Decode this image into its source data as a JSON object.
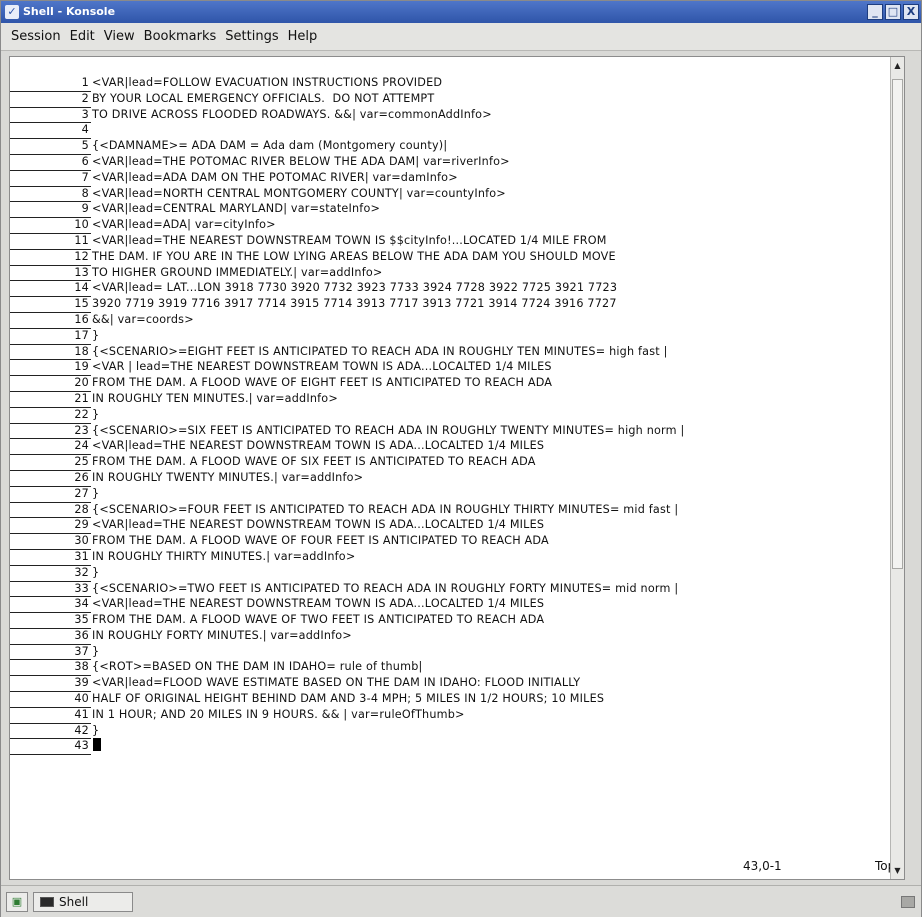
{
  "window": {
    "title": "Shell - Konsole",
    "buttons": [
      "_",
      "□",
      "X"
    ]
  },
  "menubar": {
    "items": [
      "Session",
      "Edit",
      "View",
      "Bookmarks",
      "Settings",
      "Help"
    ]
  },
  "terminal": {
    "lines": [
      {
        "n": "1",
        "text": "<VAR|lead=FOLLOW EVACUATION INSTRUCTIONS PROVIDED"
      },
      {
        "n": "2",
        "text": "BY YOUR LOCAL EMERGENCY OFFICIALS.  DO NOT ATTEMPT"
      },
      {
        "n": "3",
        "text": "TO DRIVE ACROSS FLOODED ROADWAYS. &&| var=commonAddInfo>"
      },
      {
        "n": "4",
        "text": ""
      },
      {
        "n": "5",
        "text": "{<DAMNAME>= ADA DAM = Ada dam (Montgomery county)|"
      },
      {
        "n": "6",
        "text": "<VAR|lead=THE POTOMAC RIVER BELOW THE ADA DAM| var=riverInfo>"
      },
      {
        "n": "7",
        "text": "<VAR|lead=ADA DAM ON THE POTOMAC RIVER| var=damInfo>"
      },
      {
        "n": "8",
        "text": "<VAR|lead=NORTH CENTRAL MONTGOMERY COUNTY| var=countyInfo>"
      },
      {
        "n": "9",
        "text": "<VAR|lead=CENTRAL MARYLAND| var=stateInfo>"
      },
      {
        "n": "10",
        "text": "<VAR|lead=ADA| var=cityInfo>"
      },
      {
        "n": "11",
        "text": "<VAR|lead=THE NEAREST DOWNSTREAM TOWN IS $$cityInfo!...LOCATED 1/4 MILE FROM"
      },
      {
        "n": "12",
        "text": "THE DAM. IF YOU ARE IN THE LOW LYING AREAS BELOW THE ADA DAM YOU SHOULD MOVE"
      },
      {
        "n": "13",
        "text": "TO HIGHER GROUND IMMEDIATELY.| var=addInfo>"
      },
      {
        "n": "14",
        "text": "<VAR|lead= LAT...LON 3918 7730 3920 7732 3923 7733 3924 7728 3922 7725 3921 7723"
      },
      {
        "n": "15",
        "text": "3920 7719 3919 7716 3917 7714 3915 7714 3913 7717 3913 7721 3914 7724 3916 7727"
      },
      {
        "n": "16",
        "text": "&&| var=coords>"
      },
      {
        "n": "17",
        "text": "}"
      },
      {
        "n": "18",
        "text": "{<SCENARIO>=EIGHT FEET IS ANTICIPATED TO REACH ADA IN ROUGHLY TEN MINUTES= high fast |"
      },
      {
        "n": "19",
        "text": "<VAR | lead=THE NEAREST DOWNSTREAM TOWN IS ADA...LOCALTED 1/4 MILES"
      },
      {
        "n": "20",
        "text": "FROM THE DAM. A FLOOD WAVE OF EIGHT FEET IS ANTICIPATED TO REACH ADA"
      },
      {
        "n": "21",
        "text": "IN ROUGHLY TEN MINUTES.| var=addInfo>"
      },
      {
        "n": "22",
        "text": "}"
      },
      {
        "n": "23",
        "text": "{<SCENARIO>=SIX FEET IS ANTICIPATED TO REACH ADA IN ROUGHLY TWENTY MINUTES= high norm |"
      },
      {
        "n": "24",
        "text": "<VAR|lead=THE NEAREST DOWNSTREAM TOWN IS ADA...LOCALTED 1/4 MILES"
      },
      {
        "n": "25",
        "text": "FROM THE DAM. A FLOOD WAVE OF SIX FEET IS ANTICIPATED TO REACH ADA"
      },
      {
        "n": "26",
        "text": "IN ROUGHLY TWENTY MINUTES.| var=addInfo>"
      },
      {
        "n": "27",
        "text": "}"
      },
      {
        "n": "28",
        "text": "{<SCENARIO>=FOUR FEET IS ANTICIPATED TO REACH ADA IN ROUGHLY THIRTY MINUTES= mid fast |"
      },
      {
        "n": "29",
        "text": "<VAR|lead=THE NEAREST DOWNSTREAM TOWN IS ADA...LOCALTED 1/4 MILES"
      },
      {
        "n": "30",
        "text": "FROM THE DAM. A FLOOD WAVE OF FOUR FEET IS ANTICIPATED TO REACH ADA"
      },
      {
        "n": "31",
        "text": "IN ROUGHLY THIRTY MINUTES.| var=addInfo>"
      },
      {
        "n": "32",
        "text": "}"
      },
      {
        "n": "33",
        "text": "{<SCENARIO>=TWO FEET IS ANTICIPATED TO REACH ADA IN ROUGHLY FORTY MINUTES= mid norm |"
      },
      {
        "n": "34",
        "text": "<VAR|lead=THE NEAREST DOWNSTREAM TOWN IS ADA...LOCALTED 1/4 MILES"
      },
      {
        "n": "35",
        "text": "FROM THE DAM. A FLOOD WAVE OF TWO FEET IS ANTICIPATED TO REACH ADA"
      },
      {
        "n": "36",
        "text": "IN ROUGHLY FORTY MINUTES.| var=addInfo>"
      },
      {
        "n": "37",
        "text": "}"
      },
      {
        "n": "38",
        "text": "{<ROT>=BASED ON THE DAM IN IDAHO= rule of thumb|"
      },
      {
        "n": "39",
        "text": "<VAR|lead=FLOOD WAVE ESTIMATE BASED ON THE DAM IN IDAHO: FLOOD INITIALLY"
      },
      {
        "n": "40",
        "text": "HALF OF ORIGINAL HEIGHT BEHIND DAM AND 3-4 MPH; 5 MILES IN 1/2 HOURS; 10 MILES"
      },
      {
        "n": "41",
        "text": "IN 1 HOUR; AND 20 MILES IN 9 HOURS. && | var=ruleOfThumb>"
      },
      {
        "n": "42",
        "text": "}"
      },
      {
        "n": "43",
        "text": ""
      }
    ],
    "cursor_position": "43,0-1",
    "scroll_indicator": "Top"
  },
  "taskbar": {
    "task_label": "Shell"
  }
}
